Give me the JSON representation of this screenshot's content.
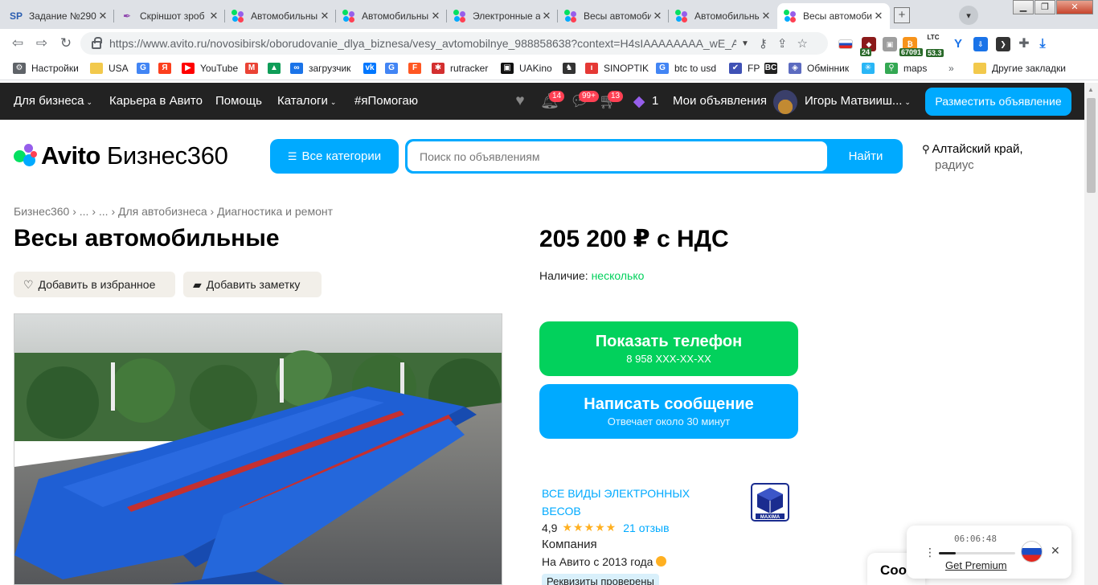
{
  "browser": {
    "tabs": [
      {
        "title": "Задание №290",
        "fav": "SP",
        "active": false
      },
      {
        "title": "Скріншот зроб",
        "fav": "feather",
        "active": false
      },
      {
        "title": "Автомобильны",
        "fav": "avito",
        "active": false
      },
      {
        "title": "Автомобильны",
        "fav": "avito",
        "active": false
      },
      {
        "title": "Электронные а",
        "fav": "avito",
        "active": false
      },
      {
        "title": "Весы автомоби",
        "fav": "avito",
        "active": false
      },
      {
        "title": "Автомобильны",
        "fav": "avito",
        "active": false
      },
      {
        "title": "Весы автомоби",
        "fav": "avito",
        "active": true
      }
    ],
    "tab_close": "✕",
    "new_tab": "+",
    "url": "https://www.avito.ru/novosibirsk/oborudovanie_dlya_biznesa/vesy_avtomobilnye_988858638?context=H4sIAAAAAAAA_wE_A...",
    "ext_badges": {
      "v24": "24",
      "btc": "67091",
      "ltc_label": "LTC",
      "ltc": "53.3"
    },
    "profile_initial": "I",
    "bookmarks": [
      {
        "label": "Настройки",
        "icon": "gear-icon",
        "color": "#5f6368"
      },
      {
        "label": "USA",
        "icon": "folder-icon",
        "color": "#f2c94c"
      },
      {
        "label": "",
        "icon": "google-icon",
        "color": "#4285f4"
      },
      {
        "label": "",
        "icon": "yandex-icon",
        "color": "#fc3f1d"
      },
      {
        "label": "YouTube",
        "icon": "youtube-icon",
        "color": "#ff0000"
      },
      {
        "label": "",
        "icon": "gmail-icon",
        "color": "#ea4335"
      },
      {
        "label": "",
        "icon": "drive-icon",
        "color": "#0f9d58"
      },
      {
        "label": "загрузчик",
        "icon": "infinity-icon",
        "color": "#1a73e8"
      },
      {
        "label": "",
        "icon": "vk-icon",
        "color": "#0077ff"
      },
      {
        "label": "",
        "icon": "translate-icon",
        "color": "#4285f4"
      },
      {
        "label": "",
        "icon": "f-icon",
        "color": "#ff5722"
      },
      {
        "label": "rutracker",
        "icon": "rutracker-icon",
        "color": "#d32f2f"
      },
      {
        "label": "UAKino",
        "icon": "uakino-icon",
        "color": "#111111"
      },
      {
        "label": "",
        "icon": "chess-icon",
        "color": "#333333"
      },
      {
        "label": "SINOPTIK",
        "icon": "thermometer-icon",
        "color": "#e53935"
      },
      {
        "label": "btc to usd",
        "icon": "google-icon",
        "color": "#4285f4"
      },
      {
        "label": "FP",
        "icon": "fp-icon",
        "color": "#3f51b5"
      },
      {
        "label": "",
        "icon": "bc-icon",
        "color": "#222222"
      },
      {
        "label": "Обмінник",
        "icon": "exchange-icon",
        "color": "#5c6bc0"
      },
      {
        "label": "",
        "icon": "snowflake-icon",
        "color": "#29b6f6"
      },
      {
        "label": "maps",
        "icon": "maps-icon",
        "color": "#34a853"
      }
    ],
    "bookmarks_more": "»",
    "other_bookmarks": "Другие закладки"
  },
  "avito_nav": {
    "items": [
      {
        "label": "Для бизнеса",
        "chevron": true
      },
      {
        "label": "Карьера в Авито",
        "chevron": false
      },
      {
        "label": "Помощь",
        "chevron": false
      },
      {
        "label": "Каталоги",
        "chevron": true
      },
      {
        "label": "#яПомогаю",
        "chevron": false
      }
    ],
    "badges": {
      "notifications": "14",
      "messages": "99+",
      "cart": "13",
      "coupons": "1"
    },
    "my_ads": "Мои объявления",
    "user_name": "Игорь Матвииш...",
    "post_ad": "Разместить объявление"
  },
  "header": {
    "logo_text": "Avito",
    "logo_sub": "Бизнес360",
    "all_categories": "Все категории",
    "search_placeholder": "Поиск по объявлениям",
    "search_button": "Найти",
    "location": "Алтайский край,",
    "location_sub": "радиус"
  },
  "breadcrumb": [
    "Бизнес360",
    "...",
    "...",
    "Для автобизнеса",
    "Диагностика и ремонт"
  ],
  "listing": {
    "title": "Весы автомобильные",
    "add_favorite": "Добавить в избранное",
    "add_note": "Добавить заметку",
    "price": "205 200 ₽ с НДС",
    "availability_label": "Наличие:",
    "availability_value": "несколько",
    "phone_button": "Показать телефон",
    "phone_masked": "8 958 XXX-XX-XX",
    "message_button": "Написать сообщение",
    "message_sub": "Отвечает около 30 минут"
  },
  "seller": {
    "name": "ВСЕ ВИДЫ ЭЛЕКТРОННЫХ ВЕСОВ",
    "rating": "4,9",
    "stars": "★★★★★",
    "reviews": "21 отзыв",
    "type": "Компания",
    "since": "На Авито с 2013 года",
    "verified": "Реквизиты проверены",
    "logo_text": "MAXIMA"
  },
  "cookie": {
    "text": "Coo"
  },
  "recorder": {
    "time": "06:06:48",
    "premium": "Get Premium",
    "progress": 0.22
  },
  "colors": {
    "avito_blue": "#00aaff",
    "avito_green": "#02d15c",
    "nav_dark": "#222222",
    "badge_red": "#ff4053",
    "star_yellow": "#ffb021"
  }
}
